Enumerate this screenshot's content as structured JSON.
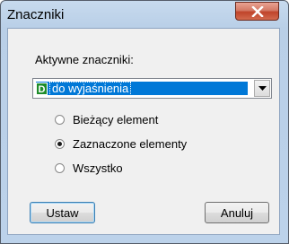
{
  "window": {
    "title": "Znaczniki",
    "close_label": "X"
  },
  "form": {
    "group_label": "Aktywne znaczniki:",
    "select": {
      "badge": "D",
      "value": "do wyjaśnienia"
    },
    "radios": [
      {
        "label": "Bieżący element",
        "checked": false
      },
      {
        "label": "Zaznaczone elementy",
        "checked": true
      },
      {
        "label": "Wszystko",
        "checked": false
      }
    ]
  },
  "buttons": {
    "set_label": "Ustaw",
    "cancel_label": "Anuluj"
  },
  "colors": {
    "selection": "#0078d7",
    "badge": "#1e8c2a",
    "close_button": "#c0442a"
  }
}
